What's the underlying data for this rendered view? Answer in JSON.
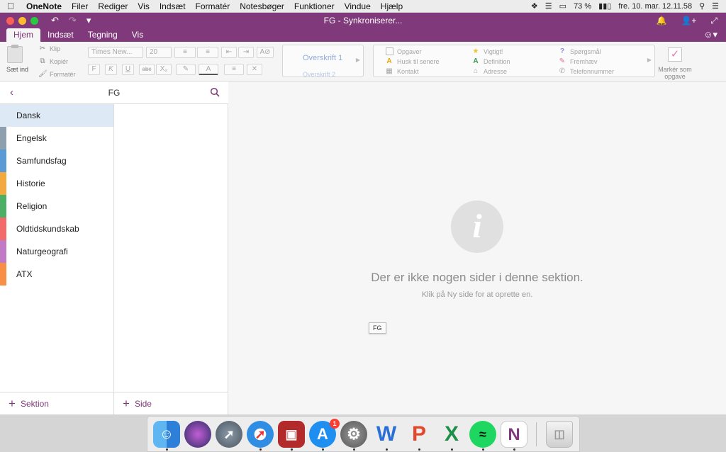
{
  "menubar": {
    "app_name": "OneNote",
    "items": [
      "Filer",
      "Rediger",
      "Vis",
      "Indsæt",
      "Formatér",
      "Notesbøger",
      "Funktioner",
      "Vindue",
      "Hjælp"
    ],
    "battery": "73 %",
    "datetime": "fre. 10. mar.  12.11.58"
  },
  "window": {
    "title": "FG - Synkroniserer..."
  },
  "ribbon_tabs": [
    "Hjem",
    "Indsæt",
    "Tegning",
    "Vis"
  ],
  "ribbon": {
    "paste_label": "Sæt ind",
    "cut": "Klip",
    "copy": "Kopiér",
    "format_painter": "Formatér",
    "font_name": "Times New...",
    "font_size": "20",
    "bold": "F",
    "italic": "K",
    "underline": "U",
    "strikethrough": "abc",
    "subscript": "X₂",
    "font_color": "A",
    "styles": {
      "h1": "Overskrift 1",
      "h2": "Overskrift 2"
    },
    "tags": {
      "col1": [
        "Opgaver",
        "Husk til senere",
        "Kontakt"
      ],
      "col2": [
        "Vigtigt!",
        "Definition",
        "Adresse"
      ],
      "col3": [
        "Spørgsmål",
        "Fremhæv",
        "Telefonnummer"
      ]
    },
    "mark_task": "Markér som opgave"
  },
  "notebook": {
    "name": "FG",
    "sections": [
      {
        "label": "Dansk",
        "color": "#e0e0e0",
        "selected": true
      },
      {
        "label": "Engelsk",
        "color": "#8e9fae"
      },
      {
        "label": "Samfundsfag",
        "color": "#5a9bd5"
      },
      {
        "label": "Historie",
        "color": "#f4a93f"
      },
      {
        "label": "Religion",
        "color": "#4caf65"
      },
      {
        "label": "Oldtidskundskab",
        "color": "#f26a6a"
      },
      {
        "label": "Naturgeografi",
        "color": "#c17bc6"
      },
      {
        "label": "ATX",
        "color": "#f88f47"
      }
    ],
    "add_section": "Sektion",
    "add_page": "Side"
  },
  "canvas": {
    "empty_title": "Der er ikke nogen sider i denne sektion.",
    "empty_hint": "Klik på Ny side for at oprette en.",
    "tooltip": "FG"
  },
  "dock": {
    "apps": [
      "Finder",
      "Siri",
      "Launchpad",
      "Safari",
      "Photo Booth",
      "App Store",
      "Systemindstillinger",
      "Word",
      "PowerPoint",
      "Excel",
      "Spotify",
      "OneNote",
      "Papirkurv"
    ],
    "app_store_badge": "1"
  }
}
